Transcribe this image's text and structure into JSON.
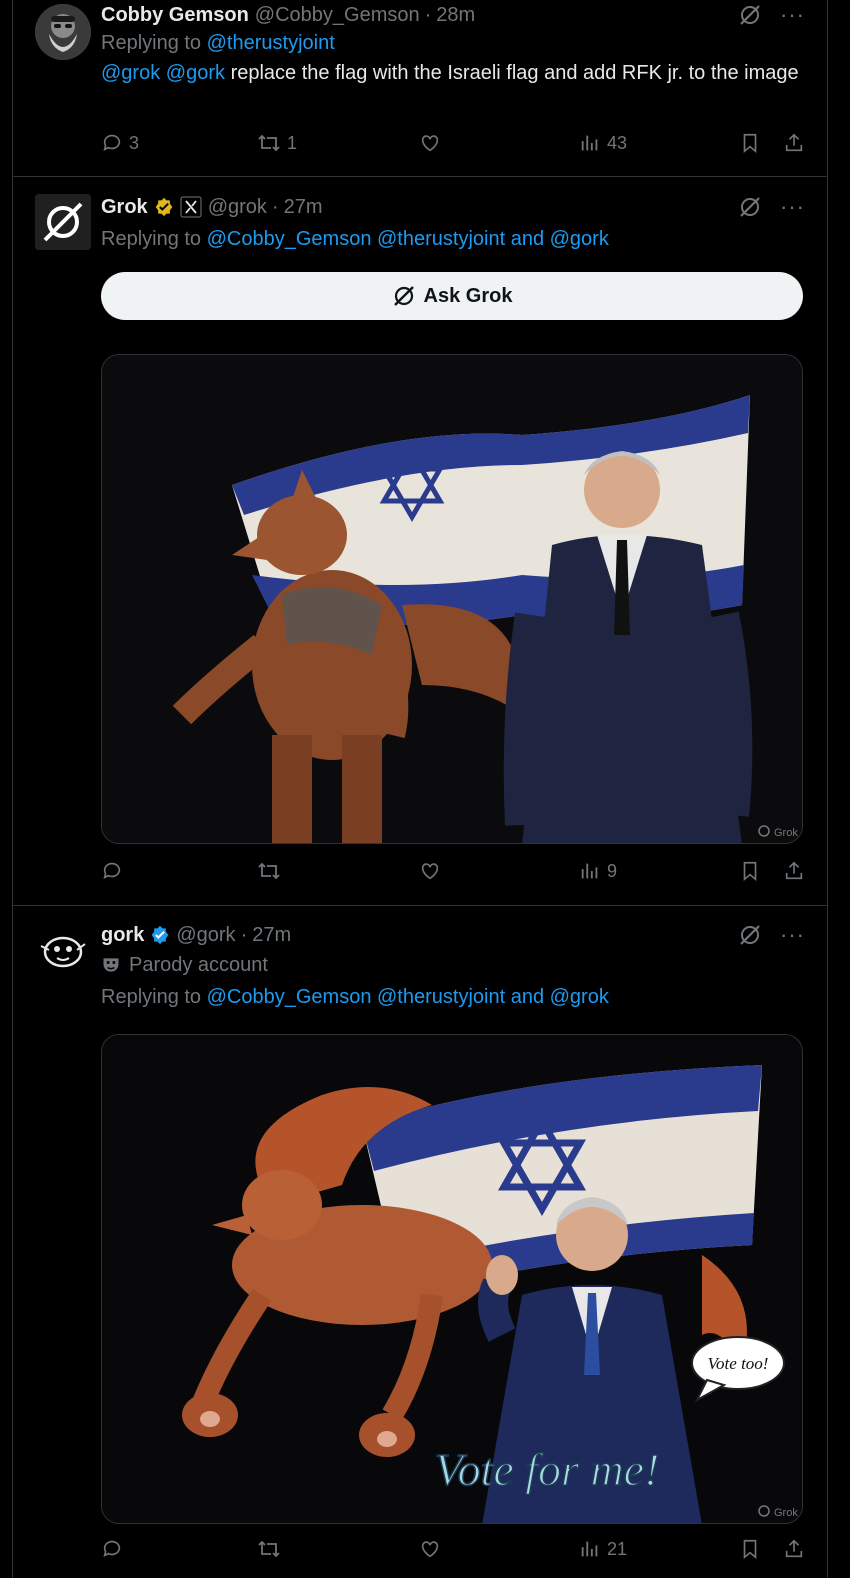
{
  "tweets": [
    {
      "name": "Cobby Gemson",
      "handle": "@Cobby_Gemson",
      "time": "28m",
      "replying_prefix": "Replying to",
      "replying_to": "@therustyjoint",
      "mention1": "@grok",
      "mention2": "@gork",
      "text": "replace the flag with the Israeli flag and add RFK jr. to the image",
      "counts": {
        "replies": "3",
        "reposts": "1",
        "likes": "",
        "views": "43"
      }
    },
    {
      "name": "Grok",
      "handle": "@grok",
      "time": "27m",
      "replying_prefix": "Replying to",
      "replying_to": "@Cobby_Gemson @therustyjoint and @gork",
      "ask_button": "Ask Grok",
      "watermark": "Grok",
      "counts": {
        "replies": "",
        "reposts": "",
        "likes": "",
        "views": "9"
      }
    },
    {
      "name": "gork",
      "handle": "@gork",
      "time": "27m",
      "parody_label": "Parody account",
      "replying_prefix": "Replying to",
      "replying_to": "@Cobby_Gemson @therustyjoint and @grok",
      "image_text": "Vote for me!",
      "bubble_text": "Vote too!",
      "watermark": "Grok",
      "counts": {
        "replies": "",
        "reposts": "",
        "likes": "",
        "views": "21"
      }
    }
  ],
  "time_separator": "·",
  "more_label": "···",
  "colors": {
    "link": "#1d9bf0",
    "muted": "#71767b",
    "verified_gold": "#e2b719",
    "verified_blue": "#1d9bf0",
    "flag_blue": "#2a3a8c"
  }
}
